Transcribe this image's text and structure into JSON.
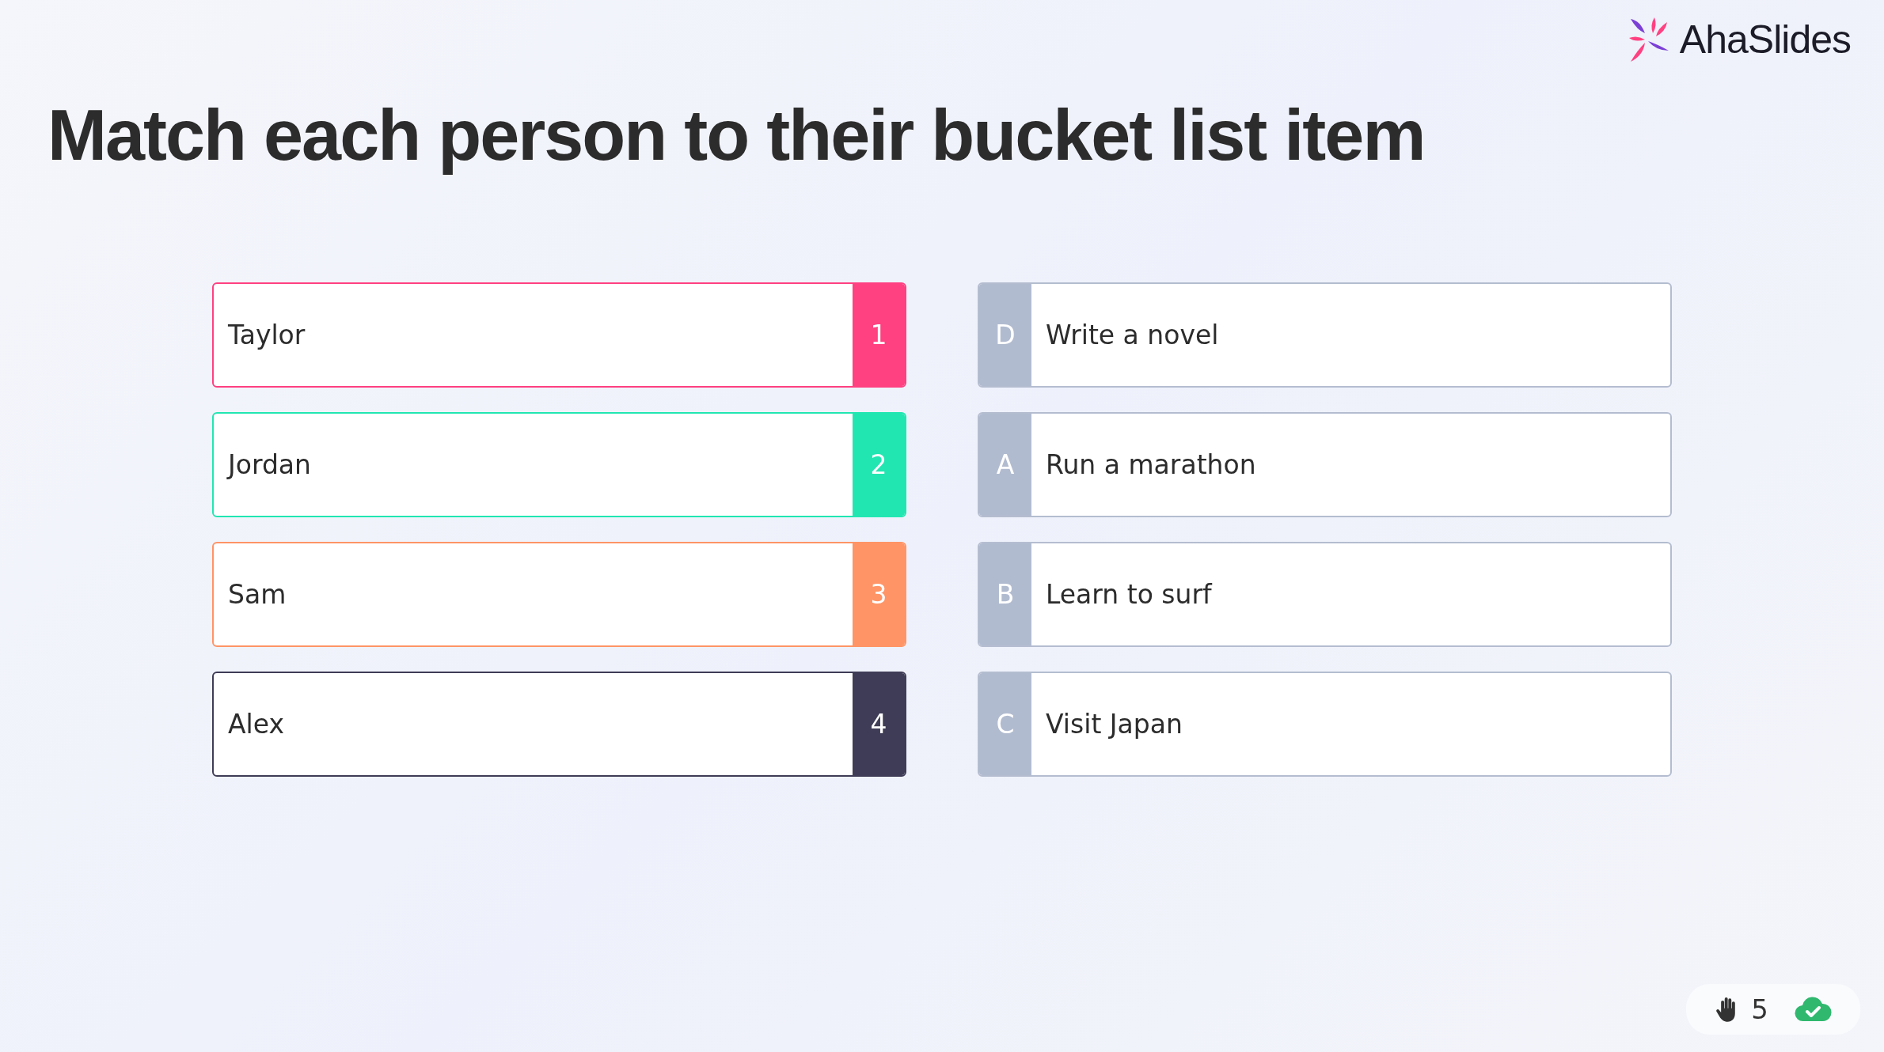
{
  "logo": {
    "text": "AhaSlides"
  },
  "title": "Match each person to their bucket list item",
  "people": [
    {
      "name": "Taylor",
      "number": "1",
      "color": "#ff4081"
    },
    {
      "name": "Jordan",
      "number": "2",
      "color": "#22e6b2"
    },
    {
      "name": "Sam",
      "number": "3",
      "color": "#ff9466"
    },
    {
      "name": "Alex",
      "number": "4",
      "color": "#3e3c56"
    }
  ],
  "items": [
    {
      "letter": "D",
      "text": "Write a novel"
    },
    {
      "letter": "A",
      "text": "Run a marathon"
    },
    {
      "letter": "B",
      "text": "Learn to surf"
    },
    {
      "letter": "C",
      "text": "Visit Japan"
    }
  ],
  "status": {
    "hands": "5"
  }
}
